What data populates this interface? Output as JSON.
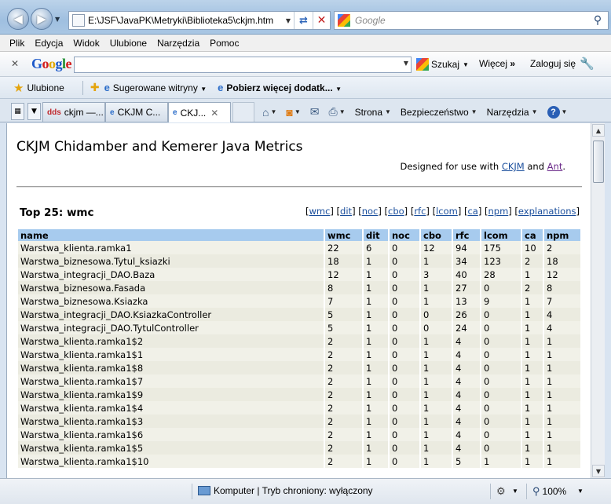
{
  "browser": {
    "address": "E:\\JSF\\JavaPK\\Metryki\\Biblioteka5\\ckjm.htm",
    "search_placeholder": "Google",
    "menu": [
      "Plik",
      "Edycja",
      "Widok",
      "Ulubione",
      "Narzędzia",
      "Pomoc"
    ],
    "toolbar": {
      "google_logo": "Google",
      "search_label": "Szukaj",
      "more_label": "Więcej",
      "more_arrows": "»",
      "signin_label": "Zaloguj się"
    },
    "favorites": {
      "label": "Ulubione",
      "suggested": "Sugerowane witryny",
      "addons": "Pobierz więcej dodatk..."
    },
    "tabs": [
      {
        "icon": "dds",
        "title": "ckjm —...",
        "active": false
      },
      {
        "icon": "e",
        "title": "CKJM C...",
        "active": false
      },
      {
        "icon": "e",
        "title": "CKJ...",
        "active": true
      }
    ],
    "commands": {
      "page": "Strona",
      "security": "Bezpieczeństwo",
      "tools": "Narzędzia"
    },
    "status": {
      "zone": "Komputer | Tryb chroniony: wyłączony",
      "zoom": "100%"
    }
  },
  "page": {
    "title": "CKJM Chidamber and Kemerer Java Metrics",
    "designed_prefix": "Designed for use with ",
    "designed_link1": "CKJM",
    "designed_mid": " and ",
    "designed_link2": "Ant",
    "designed_suffix": ".",
    "heading": "Top 25: wmc",
    "metric_links": [
      "wmc",
      "dit",
      "noc",
      "cbo",
      "rfc",
      "lcom",
      "ca",
      "npm",
      "explanations"
    ],
    "table": {
      "columns": [
        "name",
        "wmc",
        "dit",
        "noc",
        "cbo",
        "rfc",
        "lcom",
        "ca",
        "npm"
      ],
      "rows": [
        [
          "Warstwa_klienta.ramka1",
          "22",
          "6",
          "0",
          "12",
          "94",
          "175",
          "10",
          "2"
        ],
        [
          "Warstwa_biznesowa.Tytul_ksiazki",
          "18",
          "1",
          "0",
          "1",
          "34",
          "123",
          "2",
          "18"
        ],
        [
          "Warstwa_integracji_DAO.Baza",
          "12",
          "1",
          "0",
          "3",
          "40",
          "28",
          "1",
          "12"
        ],
        [
          "Warstwa_biznesowa.Fasada",
          "8",
          "1",
          "0",
          "1",
          "27",
          "0",
          "2",
          "8"
        ],
        [
          "Warstwa_biznesowa.Ksiazka",
          "7",
          "1",
          "0",
          "1",
          "13",
          "9",
          "1",
          "7"
        ],
        [
          "Warstwa_integracji_DAO.KsiazkaController",
          "5",
          "1",
          "0",
          "0",
          "26",
          "0",
          "1",
          "4"
        ],
        [
          "Warstwa_integracji_DAO.TytulController",
          "5",
          "1",
          "0",
          "0",
          "24",
          "0",
          "1",
          "4"
        ],
        [
          "Warstwa_klienta.ramka1$2",
          "2",
          "1",
          "0",
          "1",
          "4",
          "0",
          "1",
          "1"
        ],
        [
          "Warstwa_klienta.ramka1$1",
          "2",
          "1",
          "0",
          "1",
          "4",
          "0",
          "1",
          "1"
        ],
        [
          "Warstwa_klienta.ramka1$8",
          "2",
          "1",
          "0",
          "1",
          "4",
          "0",
          "1",
          "1"
        ],
        [
          "Warstwa_klienta.ramka1$7",
          "2",
          "1",
          "0",
          "1",
          "4",
          "0",
          "1",
          "1"
        ],
        [
          "Warstwa_klienta.ramka1$9",
          "2",
          "1",
          "0",
          "1",
          "4",
          "0",
          "1",
          "1"
        ],
        [
          "Warstwa_klienta.ramka1$4",
          "2",
          "1",
          "0",
          "1",
          "4",
          "0",
          "1",
          "1"
        ],
        [
          "Warstwa_klienta.ramka1$3",
          "2",
          "1",
          "0",
          "1",
          "4",
          "0",
          "1",
          "1"
        ],
        [
          "Warstwa_klienta.ramka1$6",
          "2",
          "1",
          "0",
          "1",
          "4",
          "0",
          "1",
          "1"
        ],
        [
          "Warstwa_klienta.ramka1$5",
          "2",
          "1",
          "0",
          "1",
          "4",
          "0",
          "1",
          "1"
        ],
        [
          "Warstwa_klienta.ramka1$10",
          "2",
          "1",
          "0",
          "1",
          "5",
          "1",
          "1",
          "1"
        ]
      ]
    }
  }
}
